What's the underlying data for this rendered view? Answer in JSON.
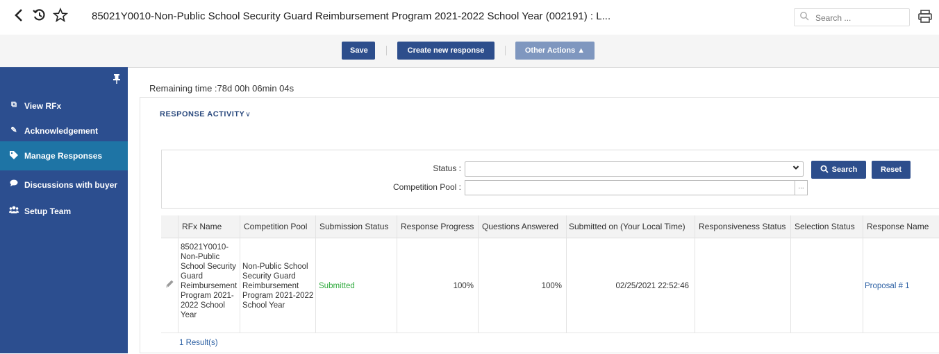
{
  "header": {
    "title": "85021Y0010-Non-Public School Security Guard Reimbursement Program 2021-2022 School Year (002191) : L...",
    "search_placeholder": "Search ...",
    "icons": [
      "back-icon",
      "history-icon",
      "star-icon",
      "search-icon",
      "print-icon"
    ]
  },
  "toolbar": {
    "save_label": "Save",
    "create_label": "Create new response",
    "other_label": "Other Actions ▲"
  },
  "sidebar": {
    "items": [
      {
        "label": "View RFx",
        "icon": "view-icon",
        "active": false
      },
      {
        "label": "Acknowledgement",
        "icon": "edit-icon",
        "active": false
      },
      {
        "label": "Manage Responses",
        "icon": "tag-icon",
        "active": true
      },
      {
        "label": "Discussions with buyer",
        "icon": "chat-icon",
        "active": false
      },
      {
        "label": "Setup Team",
        "icon": "team-icon",
        "active": false
      }
    ]
  },
  "main": {
    "remaining_time": "Remaining time :78d 00h 06min 04s",
    "section_title": "RESPONSE ACTIVITY",
    "filter": {
      "status_label": "Status :",
      "pool_label": "Competition Pool :",
      "dots": "...",
      "search_label": "Search",
      "reset_label": "Reset"
    },
    "table": {
      "columns": [
        "RFx Name",
        "Competition Pool",
        "Submission Status",
        "Response Progress",
        "Questions Answered",
        "Submitted on (Your Local Time)",
        "Responsiveness Status",
        "Selection Status",
        "Response Name"
      ],
      "rows": [
        {
          "rfx_lines": [
            "85021Y0010-",
            "Non-Public",
            "School Security",
            "Guard",
            "Reimbursement",
            "Program 2021-",
            "2022 School",
            "Year"
          ],
          "pool_lines": [
            "Non-Public School",
            "Security Guard",
            "Reimbursement",
            "Program 2021-2022",
            "School Year"
          ],
          "submission_status": "Submitted",
          "response_progress": "100%",
          "questions_answered": "100%",
          "submitted_on": "02/25/2021 22:52:46",
          "responsiveness_status": "",
          "selection_status": "",
          "response_name": "Proposal # 1"
        }
      ],
      "results": "1 Result(s)"
    }
  },
  "colors": {
    "primary": "#2d4e8c",
    "sidebar": "#2c4e8f",
    "active": "#1e74a5",
    "success": "#2eaa3c",
    "link": "#2b5fa3"
  }
}
